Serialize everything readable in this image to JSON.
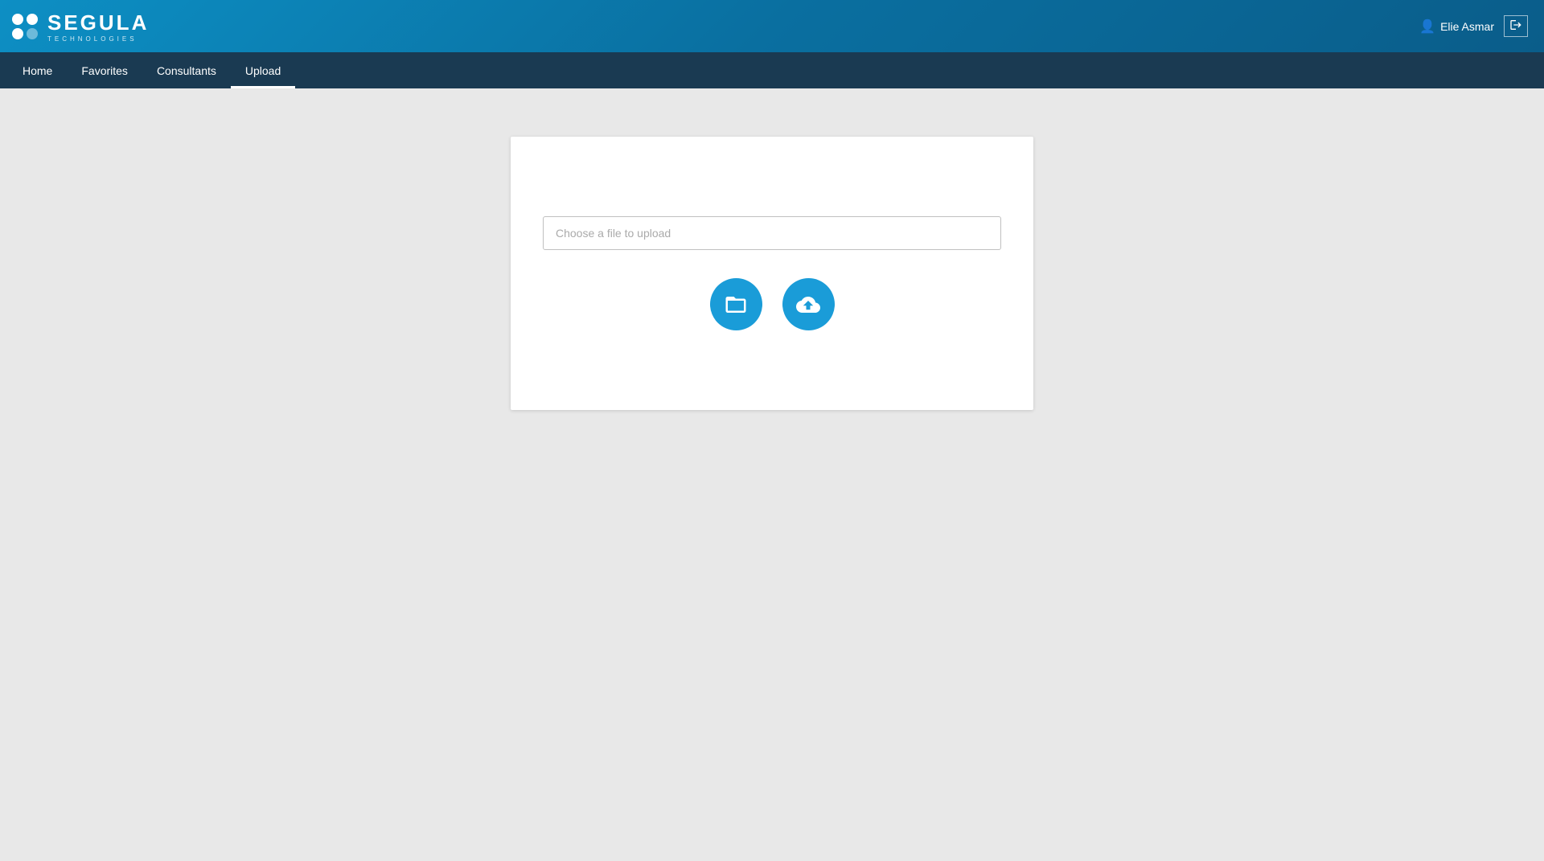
{
  "header": {
    "logo_main": "SEGULA",
    "logo_sub": "TECHNOLOGIES",
    "user_name": "Elie Asmar"
  },
  "nav": {
    "items": [
      {
        "label": "Home",
        "active": false
      },
      {
        "label": "Favorites",
        "active": false
      },
      {
        "label": "Consultants",
        "active": false
      },
      {
        "label": "Upload",
        "active": true
      }
    ]
  },
  "upload": {
    "file_input_placeholder": "Choose a file to upload",
    "browse_btn_label": "Browse",
    "upload_btn_label": "Upload"
  },
  "colors": {
    "header_bg": "#0d8fc4",
    "nav_bg": "#1a3a52",
    "accent": "#1a9cd8",
    "page_bg": "#e8e8e8"
  }
}
